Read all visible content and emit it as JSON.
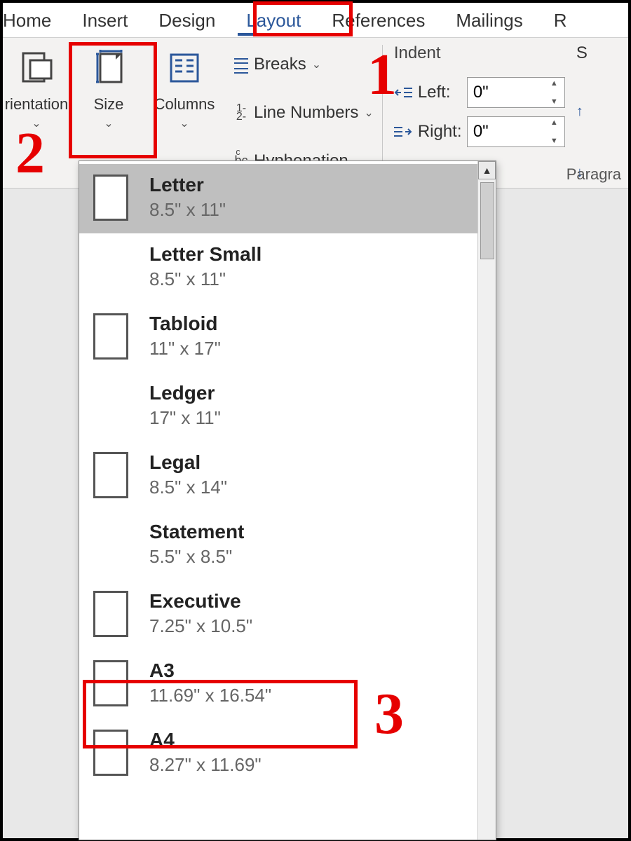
{
  "tabs": {
    "home": "Home",
    "insert": "Insert",
    "design": "Design",
    "layout": "Layout",
    "references": "References",
    "mailings": "Mailings",
    "r_cut": "R"
  },
  "ribbon": {
    "orientation": "rientation",
    "size": "Size",
    "columns": "Columns",
    "breaks": "Breaks",
    "line_numbers": "Line Numbers",
    "hyphenation": "Hyphenation",
    "indent_title": "Indent",
    "left_label": "Left:",
    "right_label": "Right:",
    "left_value": "0\"",
    "right_value": "0\"",
    "spacing_cut": "S",
    "paragraph_label": "Paragra"
  },
  "size_menu": [
    {
      "name": "Letter",
      "dims": "8.5\" x 11\"",
      "thumb": true,
      "selected": true
    },
    {
      "name": "Letter Small",
      "dims": "8.5\" x 11\"",
      "thumb": false,
      "selected": false
    },
    {
      "name": "Tabloid",
      "dims": "11\" x 17\"",
      "thumb": true,
      "selected": false
    },
    {
      "name": "Ledger",
      "dims": "17\" x 11\"",
      "thumb": false,
      "selected": false
    },
    {
      "name": "Legal",
      "dims": "8.5\" x 14\"",
      "thumb": true,
      "selected": false
    },
    {
      "name": "Statement",
      "dims": "5.5\" x 8.5\"",
      "thumb": false,
      "selected": false
    },
    {
      "name": "Executive",
      "dims": "7.25\" x 10.5\"",
      "thumb": true,
      "selected": false
    },
    {
      "name": "A3",
      "dims": "11.69\" x 16.54\"",
      "thumb": true,
      "selected": false
    },
    {
      "name": "A4",
      "dims": "8.27\" x 11.69\"",
      "thumb": true,
      "selected": false
    }
  ],
  "annotations": {
    "one": "1",
    "two": "2",
    "three": "3"
  }
}
